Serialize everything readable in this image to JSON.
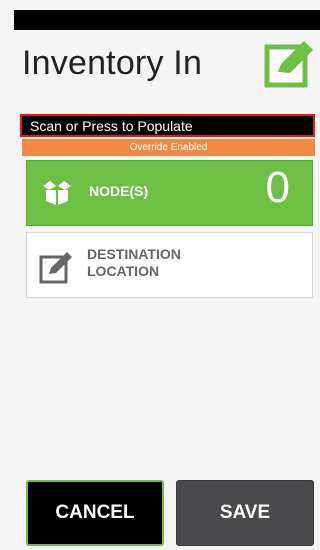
{
  "header": {
    "title": "Inventory In",
    "icon": "edit-checkbox-icon",
    "icon_color": "#6fbf44"
  },
  "scan": {
    "label": "Scan or Press to Populate",
    "border_color": "#e01b1b"
  },
  "override": {
    "text": "Override Enabled",
    "color": "#f08a43"
  },
  "nodes": {
    "icon": "box-icon",
    "label": "NODE(S)",
    "count": "0",
    "color": "#6fbf44"
  },
  "destination": {
    "icon": "edit-location-icon",
    "label": "DESTINATION LOCATION"
  },
  "actions": {
    "cancel_label": "CANCEL",
    "save_label": "SAVE"
  }
}
